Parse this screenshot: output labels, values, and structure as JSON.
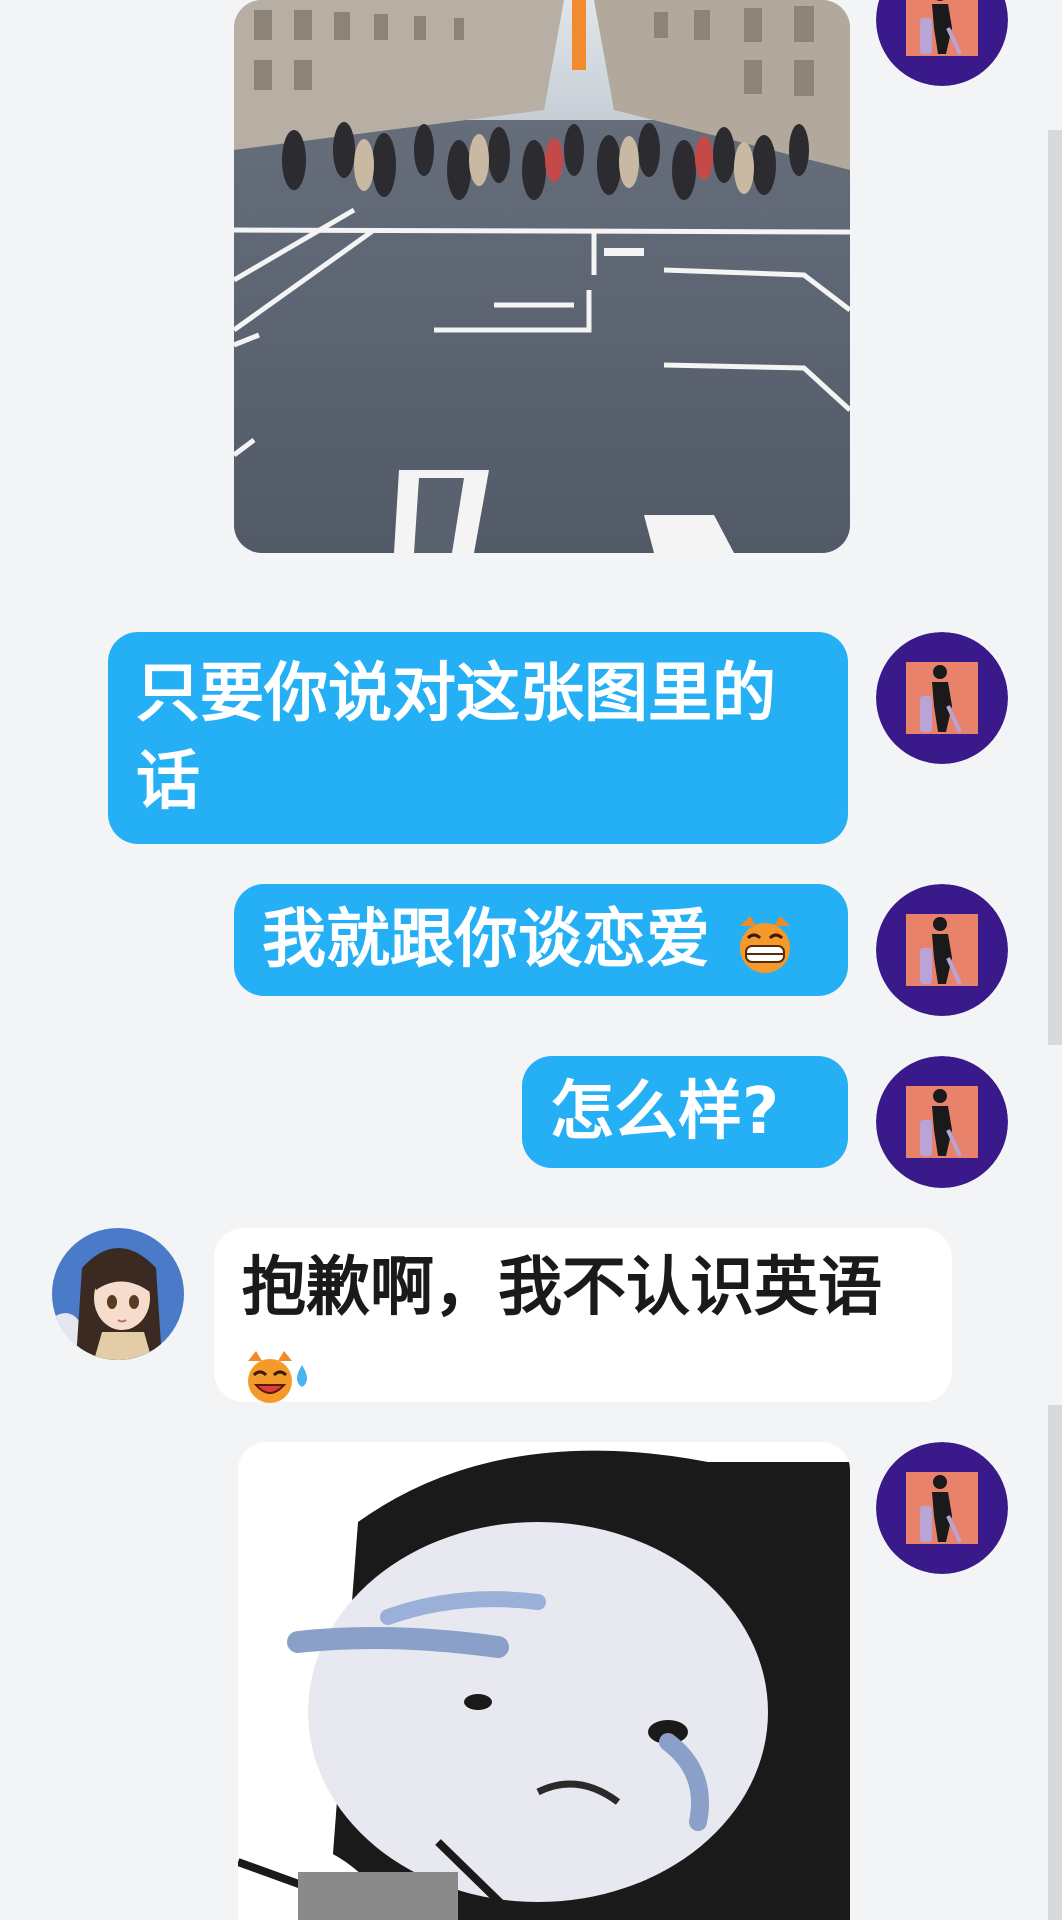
{
  "messages": [
    {
      "sender": "me",
      "type": "image",
      "content": "street-photo"
    },
    {
      "sender": "me",
      "type": "text",
      "line1": "只要你说对这张图里的",
      "line2": "话"
    },
    {
      "sender": "me",
      "type": "text",
      "text": "我就跟你谈恋爱",
      "emoji": "grin-emoji"
    },
    {
      "sender": "me",
      "type": "text",
      "text": "怎么样?"
    },
    {
      "sender": "other",
      "type": "text",
      "text": "抱歉啊，我不认识英语",
      "emoji": "sweat-laugh-emoji"
    },
    {
      "sender": "me",
      "type": "image",
      "content": "crying-meme-sticker"
    }
  ],
  "colors": {
    "background": "#f2f4f5",
    "my_bubble": "#25b0f6",
    "their_bubble": "#ffffff",
    "my_avatar_ring": "#3a1a8a",
    "my_avatar_fill": "#e8826a"
  }
}
